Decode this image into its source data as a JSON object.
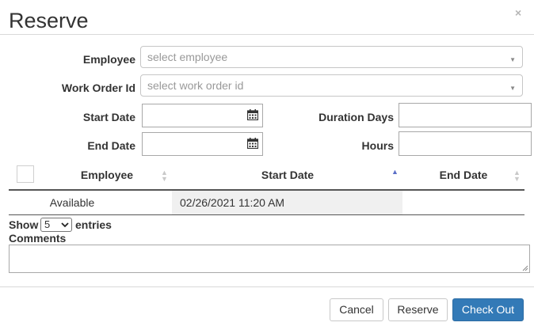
{
  "dialog": {
    "title": "Reserve",
    "close_glyph": "×"
  },
  "form": {
    "employee_label": "Employee",
    "employee_placeholder": "select employee",
    "work_order_label": "Work Order Id",
    "work_order_placeholder": "select work order id",
    "start_date_label": "Start Date",
    "start_date_value": "",
    "end_date_label": "End Date",
    "end_date_value": "",
    "duration_days_label": "Duration Days",
    "duration_days_value": "",
    "hours_label": "Hours",
    "hours_value": ""
  },
  "table": {
    "columns": [
      "Employee",
      "Start Date",
      "End Date"
    ],
    "sorted_column": "Start Date",
    "sort_direction": "ascending",
    "rows": [
      {
        "employee": "Available",
        "start_date": "02/26/2021 11:20 AM",
        "end_date": ""
      }
    ],
    "show_label": "Show",
    "page_size": "5",
    "entries_label": "entries"
  },
  "comments": {
    "label": "Comments",
    "value": ""
  },
  "footer": {
    "cancel_label": "Cancel",
    "reserve_label": "Reserve",
    "checkout_label": "Check Out"
  },
  "colors": {
    "primary": "#337ab7",
    "sort_active": "#5b6fc7",
    "row_shade": "#f0f0f0"
  },
  "icons": {
    "calendar": "calendar-icon",
    "dropdown": "chevron-down-icon",
    "close": "close-icon"
  }
}
